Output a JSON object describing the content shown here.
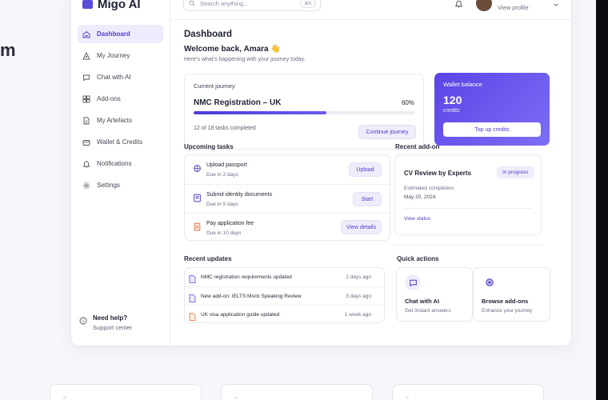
{
  "background": {
    "fragment": "m"
  },
  "app": {
    "logo_text": "Migo AI"
  },
  "sidebar": {
    "items": [
      {
        "label": "Dashboard",
        "icon": "home-icon"
      },
      {
        "label": "My Journey",
        "icon": "journey-icon"
      },
      {
        "label": "Chat with AI",
        "icon": "chat-icon"
      },
      {
        "label": "Add-ons",
        "icon": "addons-icon"
      },
      {
        "label": "My Artefacts",
        "icon": "document-icon"
      },
      {
        "label": "Wallet & Credits",
        "icon": "wallet-icon"
      },
      {
        "label": "Notifications",
        "icon": "bell-icon"
      },
      {
        "label": "Settings",
        "icon": "gear-icon"
      }
    ],
    "help_title": "Need help?",
    "help_link": "Support center"
  },
  "topbar": {
    "search_placeholder": "Search anything...",
    "search_shortcut": "⌘K",
    "profile_link": "View profile"
  },
  "dashboard": {
    "title": "Dashboard",
    "welcome": "Welcome back, Amara 👋",
    "subtitle": "Here's what's happening with your journey today."
  },
  "journey": {
    "label": "Current journey",
    "title": "NMC Registration – UK",
    "percent": "60%",
    "progress": 0.6,
    "tasks_done": "12 of 18 tasks completed",
    "continue_button": "Continue journey"
  },
  "wallet": {
    "label": "Wallet balance",
    "value": "120",
    "unit": "credits",
    "button": "Top up credits",
    "accent": "#5a44e6"
  },
  "upcoming": {
    "title": "Upcoming tasks",
    "tasks": [
      {
        "title": "Upload passport",
        "due": "Due in 2 days",
        "action": "Upload",
        "icon": "passport-icon"
      },
      {
        "title": "Submit identity documents",
        "due": "Due in 5 days",
        "action": "Start",
        "icon": "id-card-icon"
      },
      {
        "title": "Pay application fee",
        "due": "Due in 10 days",
        "action": "View details",
        "icon": "receipt-icon"
      }
    ]
  },
  "recent_addon": {
    "title": "Recent add-on",
    "name": "CV Review by Experts",
    "status": "In progress",
    "completion_label": "Estimated completion",
    "completion_date": "May 20, 2024",
    "link": "View status"
  },
  "updates": {
    "title": "Recent updates",
    "items": [
      {
        "text": "NMC registration requirements updated",
        "time": "2 days ago"
      },
      {
        "text": "New add-on: IELTS Mock Speaking Review",
        "time": "3 days ago"
      },
      {
        "text": "UK visa application guide updated",
        "time": "1 week ago"
      }
    ]
  },
  "quick_actions": {
    "title": "Quick actions",
    "items": [
      {
        "title": "Chat with AI",
        "sub": "Get instant answers",
        "icon": "chat-bubble-icon"
      },
      {
        "title": "Browse add-ons",
        "sub": "Enhance your journey",
        "icon": "addons-icon"
      }
    ]
  },
  "bottom": {
    "quote_mark": "“"
  }
}
